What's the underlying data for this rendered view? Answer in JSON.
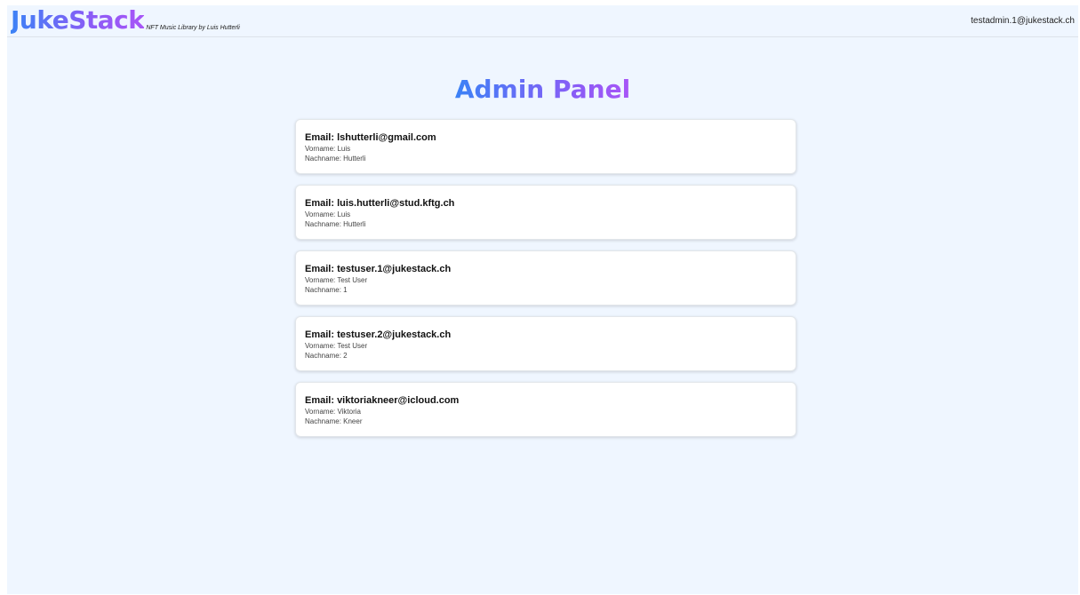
{
  "header": {
    "logo": "JukeStack",
    "tagline": "NFT Music Library by Luis Hutterli",
    "user_email": "testadmin.1@jukestack.ch"
  },
  "main": {
    "title": "Admin Panel",
    "users": [
      {
        "email_line": "Email: lshutterli@gmail.com",
        "vorname_line": "Vorname: Luis",
        "nachname_line": "Nachname: Hutterli"
      },
      {
        "email_line": "Email: luis.hutterli@stud.kftg.ch",
        "vorname_line": "Vorname: Luis",
        "nachname_line": "Nachname: Hutterli"
      },
      {
        "email_line": "Email: testuser.1@jukestack.ch",
        "vorname_line": "Vorname: Test User",
        "nachname_line": "Nachname: 1"
      },
      {
        "email_line": "Email: testuser.2@jukestack.ch",
        "vorname_line": "Vorname: Test User",
        "nachname_line": "Nachname: 2"
      },
      {
        "email_line": "Email: viktoriakneer@icloud.com",
        "vorname_line": "Vorname: Viktoria",
        "nachname_line": "Nachname: Kneer"
      }
    ]
  },
  "colors": {
    "background": "#eff6ff",
    "gradient_start": "#3b82f6",
    "gradient_end": "#a855f7",
    "card": "#ffffff"
  }
}
